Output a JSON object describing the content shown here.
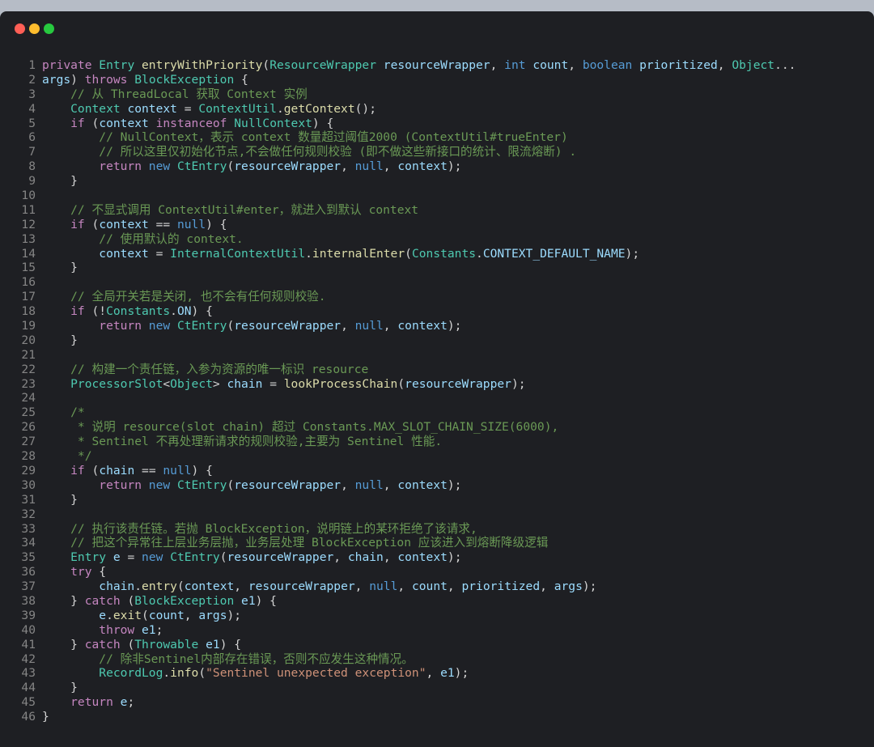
{
  "window": {
    "controls": [
      "close",
      "minimize",
      "maximize"
    ],
    "colors": {
      "close": "#ff5f56",
      "minimize": "#ffbd2e",
      "maximize": "#27c93f"
    }
  },
  "lines": [
    {
      "n": "1",
      "t": [
        [
          "kw",
          "private "
        ],
        [
          "ty",
          "Entry "
        ],
        [
          "fn",
          "entryWithPriority"
        ],
        [
          "op",
          "("
        ],
        [
          "ty",
          "ResourceWrapper "
        ],
        [
          "var",
          "resourceWrapper"
        ],
        [
          "op",
          ", "
        ],
        [
          "kw2",
          "int "
        ],
        [
          "var",
          "count"
        ],
        [
          "op",
          ", "
        ],
        [
          "kw2",
          "boolean "
        ],
        [
          "var",
          "prioritized"
        ],
        [
          "op",
          ", "
        ],
        [
          "ty",
          "Object"
        ],
        [
          "op",
          "..."
        ]
      ]
    },
    {
      "n": "2",
      "t": [
        [
          "var",
          "args"
        ],
        [
          "op",
          ") "
        ],
        [
          "kw",
          "throws "
        ],
        [
          "ty",
          "BlockException "
        ],
        [
          "op",
          "{"
        ]
      ]
    },
    {
      "n": "3",
      "t": [
        [
          "cm",
          "    // 从 ThreadLocal 获取 Context 实例"
        ]
      ]
    },
    {
      "n": "4",
      "t": [
        [
          "ty",
          "    Context "
        ],
        [
          "var",
          "context "
        ],
        [
          "op",
          "= "
        ],
        [
          "ty",
          "ContextUtil"
        ],
        [
          "op",
          "."
        ],
        [
          "fn",
          "getContext"
        ],
        [
          "op",
          "();"
        ]
      ]
    },
    {
      "n": "5",
      "t": [
        [
          "kw",
          "    if "
        ],
        [
          "op",
          "("
        ],
        [
          "var",
          "context "
        ],
        [
          "kw",
          "instanceof "
        ],
        [
          "ty",
          "NullContext"
        ],
        [
          "op",
          ") {"
        ]
      ]
    },
    {
      "n": "6",
      "t": [
        [
          "cm",
          "        // NullContext，表示 context 数量超过阈值2000 (ContextUtil#trueEnter)"
        ]
      ]
    },
    {
      "n": "7",
      "t": [
        [
          "cm",
          "        // 所以这里仅初始化节点,不会做任何规则校验 (即不做这些新接口的统计、限流熔断) ."
        ]
      ]
    },
    {
      "n": "8",
      "t": [
        [
          "kw",
          "        return "
        ],
        [
          "kw2",
          "new "
        ],
        [
          "ty",
          "CtEntry"
        ],
        [
          "op",
          "("
        ],
        [
          "var",
          "resourceWrapper"
        ],
        [
          "op",
          ", "
        ],
        [
          "kw2",
          "null"
        ],
        [
          "op",
          ", "
        ],
        [
          "var",
          "context"
        ],
        [
          "op",
          ");"
        ]
      ]
    },
    {
      "n": "9",
      "t": [
        [
          "op",
          "    }"
        ]
      ]
    },
    {
      "n": "10",
      "t": []
    },
    {
      "n": "11",
      "t": [
        [
          "cm",
          "    // 不显式调用 ContextUtil#enter，就进入到默认 context"
        ]
      ]
    },
    {
      "n": "12",
      "t": [
        [
          "kw",
          "    if "
        ],
        [
          "op",
          "("
        ],
        [
          "var",
          "context "
        ],
        [
          "op",
          "== "
        ],
        [
          "kw2",
          "null"
        ],
        [
          "op",
          ") {"
        ]
      ]
    },
    {
      "n": "13",
      "t": [
        [
          "cm",
          "        // 使用默认的 context."
        ]
      ]
    },
    {
      "n": "14",
      "t": [
        [
          "var",
          "        context "
        ],
        [
          "op",
          "= "
        ],
        [
          "ty",
          "InternalContextUtil"
        ],
        [
          "op",
          "."
        ],
        [
          "fn",
          "internalEnter"
        ],
        [
          "op",
          "("
        ],
        [
          "ty",
          "Constants"
        ],
        [
          "op",
          "."
        ],
        [
          "var",
          "CONTEXT_DEFAULT_NAME"
        ],
        [
          "op",
          ");"
        ]
      ]
    },
    {
      "n": "15",
      "t": [
        [
          "op",
          "    }"
        ]
      ]
    },
    {
      "n": "16",
      "t": []
    },
    {
      "n": "17",
      "t": [
        [
          "cm",
          "    // 全局开关若是关闭, 也不会有任何规则校验."
        ]
      ]
    },
    {
      "n": "18",
      "t": [
        [
          "kw",
          "    if "
        ],
        [
          "op",
          "(!"
        ],
        [
          "ty",
          "Constants"
        ],
        [
          "op",
          "."
        ],
        [
          "var",
          "ON"
        ],
        [
          "op",
          ") {"
        ]
      ]
    },
    {
      "n": "19",
      "t": [
        [
          "kw",
          "        return "
        ],
        [
          "kw2",
          "new "
        ],
        [
          "ty",
          "CtEntry"
        ],
        [
          "op",
          "("
        ],
        [
          "var",
          "resourceWrapper"
        ],
        [
          "op",
          ", "
        ],
        [
          "kw2",
          "null"
        ],
        [
          "op",
          ", "
        ],
        [
          "var",
          "context"
        ],
        [
          "op",
          ");"
        ]
      ]
    },
    {
      "n": "20",
      "t": [
        [
          "op",
          "    }"
        ]
      ]
    },
    {
      "n": "21",
      "t": []
    },
    {
      "n": "22",
      "t": [
        [
          "cm",
          "    // 构建一个责任链，入参为资源的唯一标识 resource"
        ]
      ]
    },
    {
      "n": "23",
      "t": [
        [
          "ty",
          "    ProcessorSlot"
        ],
        [
          "op",
          "<"
        ],
        [
          "ty",
          "Object"
        ],
        [
          "op",
          "> "
        ],
        [
          "var",
          "chain "
        ],
        [
          "op",
          "= "
        ],
        [
          "fn",
          "lookProcessChain"
        ],
        [
          "op",
          "("
        ],
        [
          "var",
          "resourceWrapper"
        ],
        [
          "op",
          ");"
        ]
      ]
    },
    {
      "n": "24",
      "t": []
    },
    {
      "n": "25",
      "t": [
        [
          "cm",
          "    /*"
        ]
      ]
    },
    {
      "n": "26",
      "t": [
        [
          "cm",
          "     * 说明 resource(slot chain) 超过 Constants.MAX_SLOT_CHAIN_SIZE(6000),"
        ]
      ]
    },
    {
      "n": "27",
      "t": [
        [
          "cm",
          "     * Sentinel 不再处理新请求的规则校验,主要为 Sentinel 性能."
        ]
      ]
    },
    {
      "n": "28",
      "t": [
        [
          "cm",
          "     */"
        ]
      ]
    },
    {
      "n": "29",
      "t": [
        [
          "kw",
          "    if "
        ],
        [
          "op",
          "("
        ],
        [
          "var",
          "chain "
        ],
        [
          "op",
          "== "
        ],
        [
          "kw2",
          "null"
        ],
        [
          "op",
          ") {"
        ]
      ]
    },
    {
      "n": "30",
      "t": [
        [
          "kw",
          "        return "
        ],
        [
          "kw2",
          "new "
        ],
        [
          "ty",
          "CtEntry"
        ],
        [
          "op",
          "("
        ],
        [
          "var",
          "resourceWrapper"
        ],
        [
          "op",
          ", "
        ],
        [
          "kw2",
          "null"
        ],
        [
          "op",
          ", "
        ],
        [
          "var",
          "context"
        ],
        [
          "op",
          ");"
        ]
      ]
    },
    {
      "n": "31",
      "t": [
        [
          "op",
          "    }"
        ]
      ]
    },
    {
      "n": "32",
      "t": []
    },
    {
      "n": "33",
      "t": [
        [
          "cm",
          "    // 执行该责任链。若抛 BlockException，说明链上的某环拒绝了该请求,"
        ]
      ]
    },
    {
      "n": "34",
      "t": [
        [
          "cm",
          "    // 把这个异常往上层业务层抛，业务层处理 BlockException 应该进入到熔断降级逻辑"
        ]
      ]
    },
    {
      "n": "35",
      "t": [
        [
          "ty",
          "    Entry "
        ],
        [
          "var",
          "e "
        ],
        [
          "op",
          "= "
        ],
        [
          "kw2",
          "new "
        ],
        [
          "ty",
          "CtEntry"
        ],
        [
          "op",
          "("
        ],
        [
          "var",
          "resourceWrapper"
        ],
        [
          "op",
          ", "
        ],
        [
          "var",
          "chain"
        ],
        [
          "op",
          ", "
        ],
        [
          "var",
          "context"
        ],
        [
          "op",
          ");"
        ]
      ]
    },
    {
      "n": "36",
      "t": [
        [
          "kw",
          "    try "
        ],
        [
          "op",
          "{"
        ]
      ]
    },
    {
      "n": "37",
      "t": [
        [
          "var",
          "        chain"
        ],
        [
          "op",
          "."
        ],
        [
          "fn",
          "entry"
        ],
        [
          "op",
          "("
        ],
        [
          "var",
          "context"
        ],
        [
          "op",
          ", "
        ],
        [
          "var",
          "resourceWrapper"
        ],
        [
          "op",
          ", "
        ],
        [
          "kw2",
          "null"
        ],
        [
          "op",
          ", "
        ],
        [
          "var",
          "count"
        ],
        [
          "op",
          ", "
        ],
        [
          "var",
          "prioritized"
        ],
        [
          "op",
          ", "
        ],
        [
          "var",
          "args"
        ],
        [
          "op",
          ");"
        ]
      ]
    },
    {
      "n": "38",
      "t": [
        [
          "op",
          "    } "
        ],
        [
          "kw",
          "catch "
        ],
        [
          "op",
          "("
        ],
        [
          "ty",
          "BlockException "
        ],
        [
          "var",
          "e1"
        ],
        [
          "op",
          ") {"
        ]
      ]
    },
    {
      "n": "39",
      "t": [
        [
          "var",
          "        e"
        ],
        [
          "op",
          "."
        ],
        [
          "fn",
          "exit"
        ],
        [
          "op",
          "("
        ],
        [
          "var",
          "count"
        ],
        [
          "op",
          ", "
        ],
        [
          "var",
          "args"
        ],
        [
          "op",
          ");"
        ]
      ]
    },
    {
      "n": "40",
      "t": [
        [
          "kw",
          "        throw "
        ],
        [
          "var",
          "e1"
        ],
        [
          "op",
          ";"
        ]
      ]
    },
    {
      "n": "41",
      "t": [
        [
          "op",
          "    } "
        ],
        [
          "kw",
          "catch "
        ],
        [
          "op",
          "("
        ],
        [
          "ty",
          "Throwable "
        ],
        [
          "var",
          "e1"
        ],
        [
          "op",
          ") {"
        ]
      ]
    },
    {
      "n": "42",
      "t": [
        [
          "cm",
          "        // 除非Sentinel内部存在错误，否则不应发生这种情况。"
        ]
      ]
    },
    {
      "n": "43",
      "t": [
        [
          "ty",
          "        RecordLog"
        ],
        [
          "op",
          "."
        ],
        [
          "fn",
          "info"
        ],
        [
          "op",
          "("
        ],
        [
          "str",
          "\"Sentinel unexpected exception\""
        ],
        [
          "op",
          ", "
        ],
        [
          "var",
          "e1"
        ],
        [
          "op",
          ");"
        ]
      ]
    },
    {
      "n": "44",
      "t": [
        [
          "op",
          "    }"
        ]
      ]
    },
    {
      "n": "45",
      "t": [
        [
          "kw",
          "    return "
        ],
        [
          "var",
          "e"
        ],
        [
          "op",
          ";"
        ]
      ]
    },
    {
      "n": "46",
      "t": [
        [
          "op",
          "}"
        ]
      ]
    }
  ]
}
